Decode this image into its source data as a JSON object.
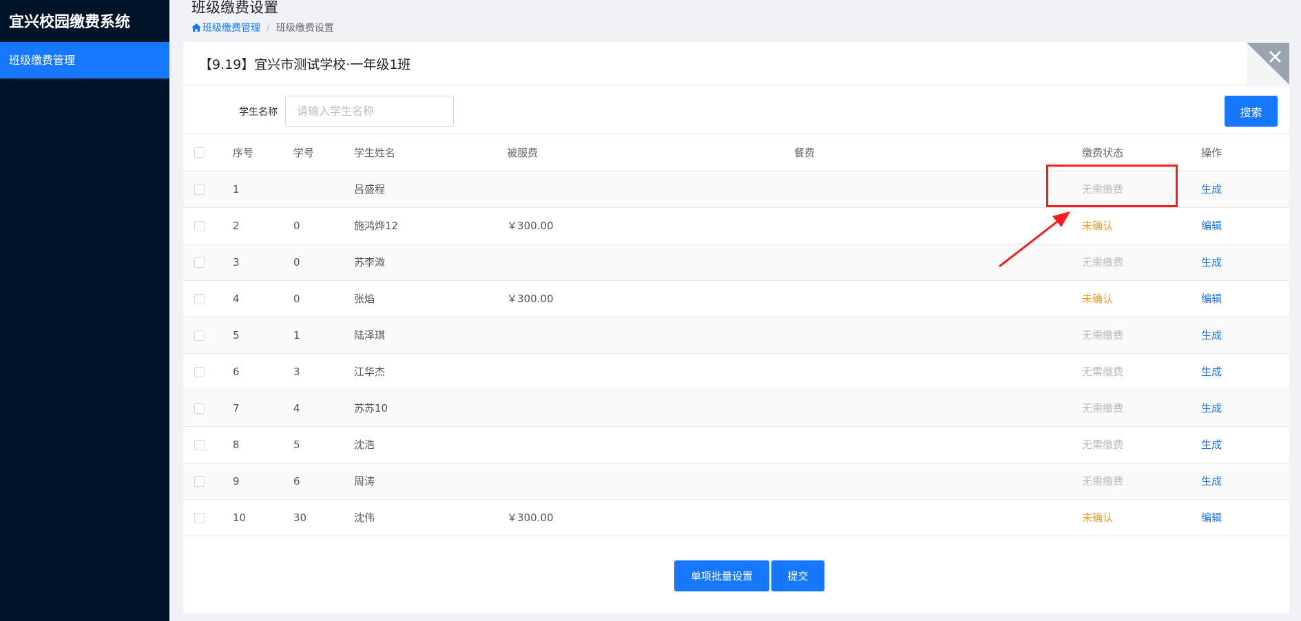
{
  "sidebar": {
    "brand": "宜兴校园缴费系统",
    "items": [
      {
        "label": "班级缴费管理",
        "active": true
      }
    ]
  },
  "header": {
    "title": "班级缴费设置",
    "breadcrumb": {
      "link": "班级缴费管理",
      "current": "班级缴费设置"
    }
  },
  "panel": {
    "title": "【9.19】宜兴市测试学校·一年级1班"
  },
  "search": {
    "label": "学生名称",
    "placeholder": "请输入学生名称",
    "value": "",
    "button": "搜索"
  },
  "table": {
    "columns": {
      "no": "序号",
      "student_id": "学号",
      "name": "学生姓名",
      "uniform": "被服费",
      "meal": "餐费",
      "status": "缴费状态",
      "op": "操作"
    },
    "rows": [
      {
        "no": "1",
        "student_id": "",
        "name": "吕盛程",
        "uniform": "",
        "meal": "",
        "status": "无需缴费",
        "status_type": "none",
        "op": "生成"
      },
      {
        "no": "2",
        "student_id": "0",
        "name": "施鸿烨12",
        "uniform": "￥300.00",
        "meal": "",
        "status": "未确认",
        "status_type": "pending",
        "op": "编辑"
      },
      {
        "no": "3",
        "student_id": "0",
        "name": "苏李溦",
        "uniform": "",
        "meal": "",
        "status": "无需缴费",
        "status_type": "none",
        "op": "生成"
      },
      {
        "no": "4",
        "student_id": "0",
        "name": "张焰",
        "uniform": "￥300.00",
        "meal": "",
        "status": "未确认",
        "status_type": "pending",
        "op": "编辑"
      },
      {
        "no": "5",
        "student_id": "1",
        "name": "陆泽琪",
        "uniform": "",
        "meal": "",
        "status": "无需缴费",
        "status_type": "none",
        "op": "生成"
      },
      {
        "no": "6",
        "student_id": "3",
        "name": "江华杰",
        "uniform": "",
        "meal": "",
        "status": "无需缴费",
        "status_type": "none",
        "op": "生成"
      },
      {
        "no": "7",
        "student_id": "4",
        "name": "苏苏10",
        "uniform": "",
        "meal": "",
        "status": "无需缴费",
        "status_type": "none",
        "op": "生成"
      },
      {
        "no": "8",
        "student_id": "5",
        "name": "沈浩",
        "uniform": "",
        "meal": "",
        "status": "无需缴费",
        "status_type": "none",
        "op": "生成"
      },
      {
        "no": "9",
        "student_id": "6",
        "name": "周涛",
        "uniform": "",
        "meal": "",
        "status": "无需缴费",
        "status_type": "none",
        "op": "生成"
      },
      {
        "no": "10",
        "student_id": "30",
        "name": "沈伟",
        "uniform": "￥300.00",
        "meal": "",
        "status": "未确认",
        "status_type": "pending",
        "op": "编辑"
      }
    ]
  },
  "footer": {
    "batch_button": "单项批量设置",
    "submit_button": "提交"
  },
  "icons": {
    "home": "home-icon",
    "close": "close-icon",
    "annotation": "arrow-annotation-icon"
  },
  "colors": {
    "sidebar_bg": "#001529",
    "accent": "#1677ff",
    "pending": "#e6a23c",
    "none_status": "#bbbbbb",
    "annotation": "#ff1a1a"
  }
}
